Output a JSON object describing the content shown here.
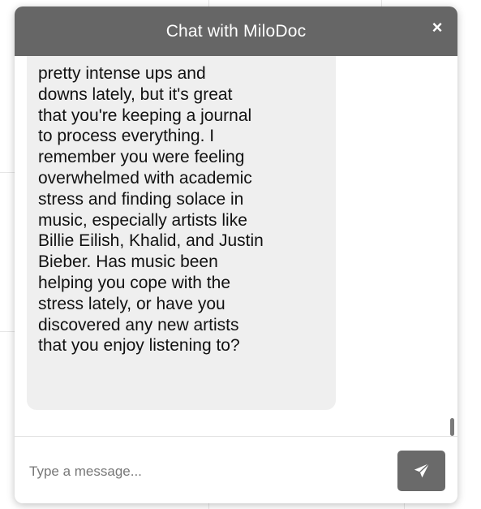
{
  "header": {
    "title": "Chat with MiloDoc",
    "close_label": "×"
  },
  "messages": [
    {
      "sender": "bot",
      "text": "pretty intense ups and\ndowns lately, but it's great\nthat you're keeping a journal\nto process everything. I\nremember you were feeling\noverwhelmed with academic\nstress and finding solace in\nmusic, especially artists like\nBillie Eilish, Khalid, and Justin\nBieber. Has music been\nhelping you cope with the\nstress lately, or have you\ndiscovered any new artists\nthat you enjoy listening to?"
    }
  ],
  "composer": {
    "placeholder": "Type a message...",
    "value": "",
    "send_icon": "send-icon"
  },
  "colors": {
    "header_bg": "#666666",
    "bubble_bg": "#efefef",
    "send_button_bg": "#6a6a6a"
  }
}
